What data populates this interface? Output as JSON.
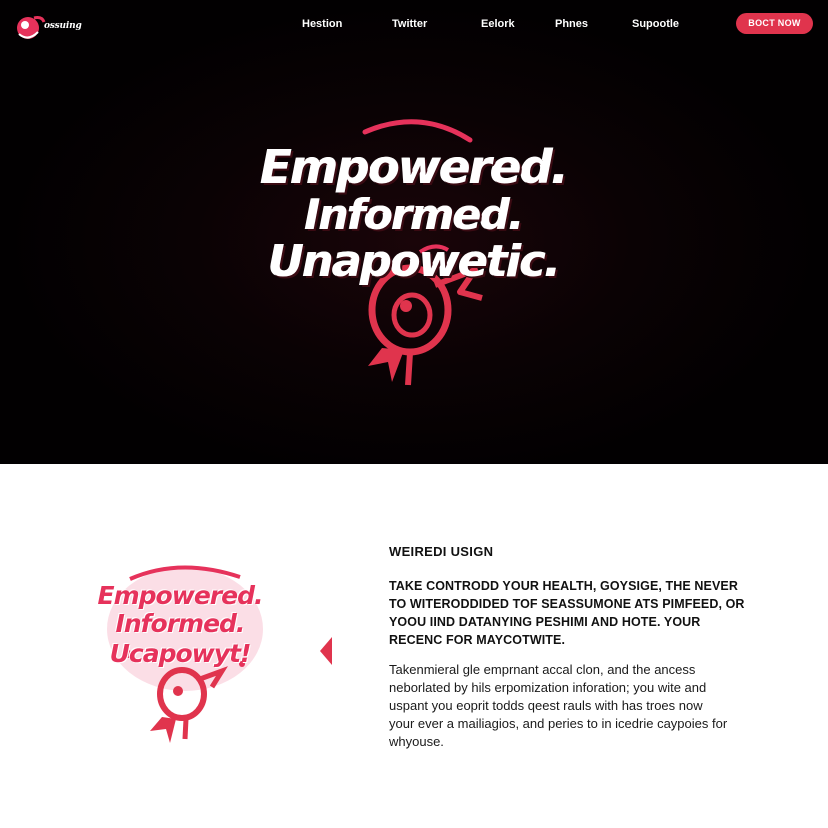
{
  "brand": {
    "name": "ossuing",
    "accent": "#e0344d",
    "pink": "#e6325b",
    "hero_bg": "#050102"
  },
  "nav": {
    "items": [
      "Hestion",
      "Twitter",
      "Eelork",
      "Phnes",
      "Supootle"
    ],
    "cta": "BOCT NOW"
  },
  "hero": {
    "line1": "Empowered.",
    "line2": "Informed.",
    "line3": "Unapowetic."
  },
  "badge": {
    "line1": "Empowered.",
    "line2": "Informed.",
    "line3": "Ucapowyt!"
  },
  "content": {
    "eyebrow": "WEIREDI USIGN",
    "headline_lines": [
      "TAKE CONTRODD YOUR HEALTH, GOYSIGE, THE NEVER",
      "TO WITERODDIDED TOF SEASSUMONE ATS PIMFEED, OR",
      "YOOU IIND DATANYING PESHIMI AND HOTE. YOUR",
      "RECENC FOR MAYCOTWITE."
    ],
    "body_lines": [
      "Takenmieral gle emprnant accal clon, and the ancess",
      "neborlated by hils erpomization inforation; you wite and",
      "uspant you eoprit todds qeest rauls with has troes now",
      "your ever a mailiagios, and peries to in icedrie caypoies for",
      "whyouse."
    ]
  }
}
